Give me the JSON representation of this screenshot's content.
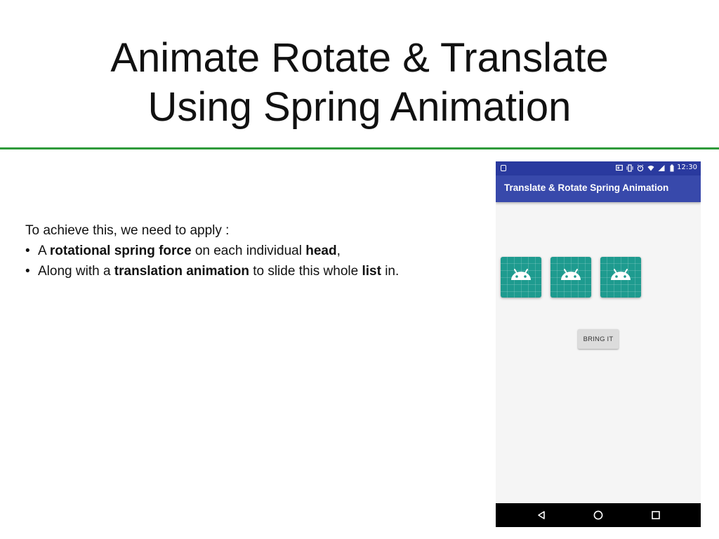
{
  "slide": {
    "title_line1": "Animate Rotate & Translate",
    "title_line2": "Using Spring Animation",
    "rule_color": "#2f9a3a"
  },
  "body": {
    "intro": "To achieve this, we need to apply :",
    "bullets": [
      {
        "pre": "A ",
        "bold1": "rotational spring force",
        "mid": " on each individual ",
        "bold2": "head",
        "post": ","
      },
      {
        "pre": "Along with a ",
        "bold1": "translation animation",
        "mid": " to slide this whole ",
        "bold2": "list",
        "post": " in."
      }
    ]
  },
  "phone": {
    "status_bar": {
      "time": "12:30",
      "icons": [
        "notification-icon",
        "cast-icon",
        "vibrate-icon",
        "alarm-icon",
        "wifi-icon",
        "signal-icon",
        "battery-icon"
      ],
      "color": "#2a3a9f"
    },
    "app_bar": {
      "title": "Translate & Rotate Spring Animation",
      "color": "#3849ab"
    },
    "heads": [
      {
        "icon": "android-head-icon"
      },
      {
        "icon": "android-head-icon"
      },
      {
        "icon": "android-head-icon"
      }
    ],
    "head_color": "#1e9b8f",
    "button_label": "BRING IT",
    "nav_bar": {
      "icons": [
        "back-icon",
        "home-icon",
        "recents-icon"
      ]
    }
  }
}
